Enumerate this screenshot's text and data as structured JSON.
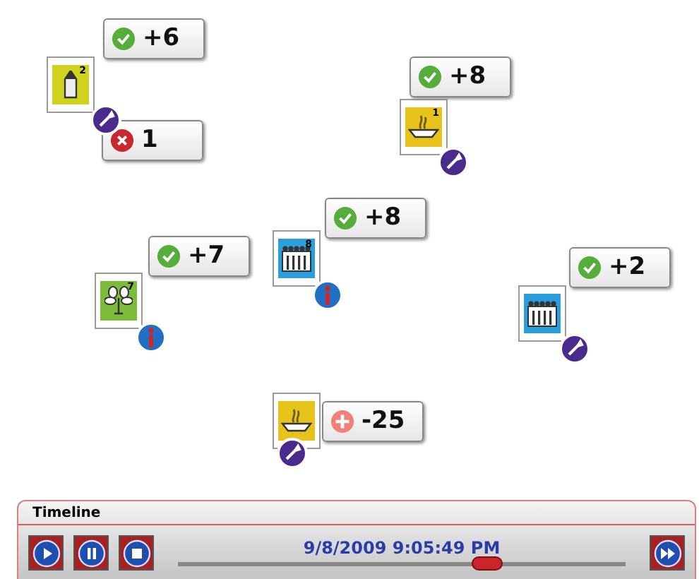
{
  "nodes": [
    {
      "kind": "pen",
      "color": "#cfd21e",
      "sup": "2",
      "badge": {
        "kind": "tool"
      },
      "callouts": [
        {
          "kind": "ok",
          "value": "+6"
        },
        {
          "kind": "error",
          "value": "1"
        }
      ]
    },
    {
      "kind": "soup",
      "color": "#e8c31c",
      "sup": "1",
      "badge": {
        "kind": "tool"
      },
      "callouts": [
        {
          "kind": "ok",
          "value": "+8"
        }
      ]
    },
    {
      "kind": "flower",
      "color": "#7dbb3c",
      "sup": "7",
      "badge": {
        "kind": "info"
      },
      "callouts": [
        {
          "kind": "ok",
          "value": "+7"
        }
      ]
    },
    {
      "kind": "people",
      "color": "#2a9fdc",
      "sup": "8",
      "badge": {
        "kind": "info"
      },
      "callouts": [
        {
          "kind": "ok",
          "value": "+8"
        }
      ]
    },
    {
      "kind": "people",
      "color": "#2a9fdc",
      "badge": {
        "kind": "tool"
      },
      "callouts": [
        {
          "kind": "ok",
          "value": "+2"
        }
      ]
    },
    {
      "kind": "soup",
      "color": "#e8c31c",
      "badge": {
        "kind": "tool"
      },
      "callouts": [
        {
          "kind": "add",
          "value": "-25"
        }
      ]
    }
  ],
  "timeline": {
    "title": "Timeline",
    "time": "9/8/2009 9:05:49 PM",
    "level": 0.69
  }
}
